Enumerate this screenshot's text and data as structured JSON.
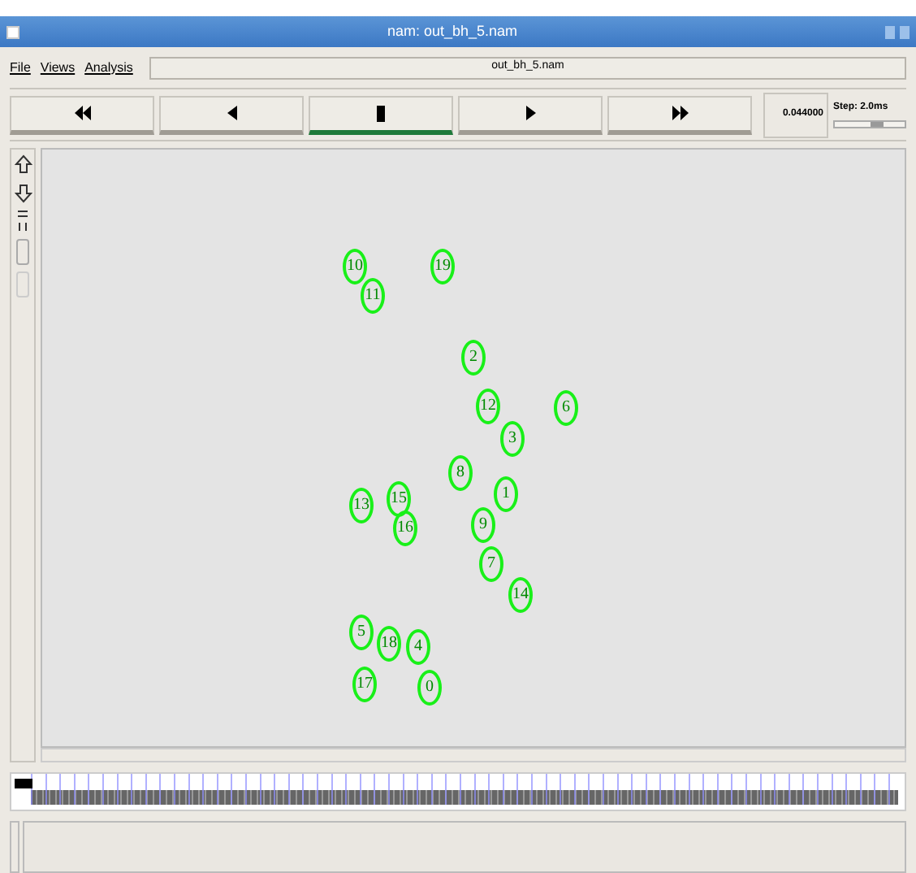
{
  "window": {
    "title": "nam: out_bh_5.nam"
  },
  "menu": [
    {
      "label": "File"
    },
    {
      "label": "Views"
    },
    {
      "label": "Analysis"
    }
  ],
  "file_label": "out_bh_5.nam",
  "controls": [
    {
      "kind": "rewind",
      "selected": false
    },
    {
      "kind": "back",
      "selected": false
    },
    {
      "kind": "stop",
      "selected": true
    },
    {
      "kind": "play",
      "selected": false
    },
    {
      "kind": "forward",
      "selected": false
    }
  ],
  "time": "0.044000",
  "step": {
    "label": "Step: 2.0ms",
    "level": 0.6
  },
  "nodes": [
    "10",
    "19",
    "11",
    "2",
    "12",
    "6",
    "3",
    "8",
    "1",
    "13",
    "15",
    "16",
    "9",
    "7",
    "14",
    "5",
    "18",
    "4",
    "17",
    "0"
  ]
}
